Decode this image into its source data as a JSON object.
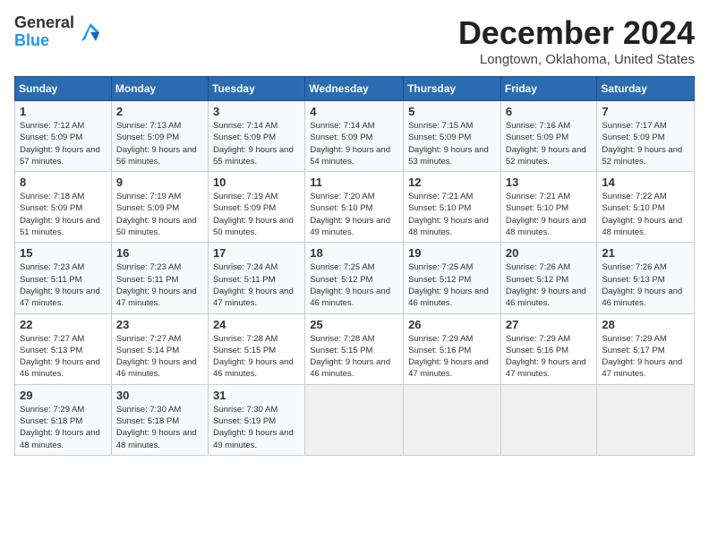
{
  "logo": {
    "general": "General",
    "blue": "Blue"
  },
  "title": "December 2024",
  "location": "Longtown, Oklahoma, United States",
  "days_of_week": [
    "Sunday",
    "Monday",
    "Tuesday",
    "Wednesday",
    "Thursday",
    "Friday",
    "Saturday"
  ],
  "weeks": [
    [
      {
        "day": "1",
        "sunrise": "7:12 AM",
        "sunset": "5:09 PM",
        "daylight": "9 hours and 57 minutes."
      },
      {
        "day": "2",
        "sunrise": "7:13 AM",
        "sunset": "5:09 PM",
        "daylight": "9 hours and 56 minutes."
      },
      {
        "day": "3",
        "sunrise": "7:14 AM",
        "sunset": "5:09 PM",
        "daylight": "9 hours and 55 minutes."
      },
      {
        "day": "4",
        "sunrise": "7:14 AM",
        "sunset": "5:09 PM",
        "daylight": "9 hours and 54 minutes."
      },
      {
        "day": "5",
        "sunrise": "7:15 AM",
        "sunset": "5:09 PM",
        "daylight": "9 hours and 53 minutes."
      },
      {
        "day": "6",
        "sunrise": "7:16 AM",
        "sunset": "5:09 PM",
        "daylight": "9 hours and 52 minutes."
      },
      {
        "day": "7",
        "sunrise": "7:17 AM",
        "sunset": "5:09 PM",
        "daylight": "9 hours and 52 minutes."
      }
    ],
    [
      {
        "day": "8",
        "sunrise": "7:18 AM",
        "sunset": "5:09 PM",
        "daylight": "9 hours and 51 minutes."
      },
      {
        "day": "9",
        "sunrise": "7:19 AM",
        "sunset": "5:09 PM",
        "daylight": "9 hours and 50 minutes."
      },
      {
        "day": "10",
        "sunrise": "7:19 AM",
        "sunset": "5:09 PM",
        "daylight": "9 hours and 50 minutes."
      },
      {
        "day": "11",
        "sunrise": "7:20 AM",
        "sunset": "5:10 PM",
        "daylight": "9 hours and 49 minutes."
      },
      {
        "day": "12",
        "sunrise": "7:21 AM",
        "sunset": "5:10 PM",
        "daylight": "9 hours and 48 minutes."
      },
      {
        "day": "13",
        "sunrise": "7:21 AM",
        "sunset": "5:10 PM",
        "daylight": "9 hours and 48 minutes."
      },
      {
        "day": "14",
        "sunrise": "7:22 AM",
        "sunset": "5:10 PM",
        "daylight": "9 hours and 48 minutes."
      }
    ],
    [
      {
        "day": "15",
        "sunrise": "7:23 AM",
        "sunset": "5:11 PM",
        "daylight": "9 hours and 47 minutes."
      },
      {
        "day": "16",
        "sunrise": "7:23 AM",
        "sunset": "5:11 PM",
        "daylight": "9 hours and 47 minutes."
      },
      {
        "day": "17",
        "sunrise": "7:24 AM",
        "sunset": "5:11 PM",
        "daylight": "9 hours and 47 minutes."
      },
      {
        "day": "18",
        "sunrise": "7:25 AM",
        "sunset": "5:12 PM",
        "daylight": "9 hours and 46 minutes."
      },
      {
        "day": "19",
        "sunrise": "7:25 AM",
        "sunset": "5:12 PM",
        "daylight": "9 hours and 46 minutes."
      },
      {
        "day": "20",
        "sunrise": "7:26 AM",
        "sunset": "5:12 PM",
        "daylight": "9 hours and 46 minutes."
      },
      {
        "day": "21",
        "sunrise": "7:26 AM",
        "sunset": "5:13 PM",
        "daylight": "9 hours and 46 minutes."
      }
    ],
    [
      {
        "day": "22",
        "sunrise": "7:27 AM",
        "sunset": "5:13 PM",
        "daylight": "9 hours and 46 minutes."
      },
      {
        "day": "23",
        "sunrise": "7:27 AM",
        "sunset": "5:14 PM",
        "daylight": "9 hours and 46 minutes."
      },
      {
        "day": "24",
        "sunrise": "7:28 AM",
        "sunset": "5:15 PM",
        "daylight": "9 hours and 46 minutes."
      },
      {
        "day": "25",
        "sunrise": "7:28 AM",
        "sunset": "5:15 PM",
        "daylight": "9 hours and 46 minutes."
      },
      {
        "day": "26",
        "sunrise": "7:29 AM",
        "sunset": "5:16 PM",
        "daylight": "9 hours and 47 minutes."
      },
      {
        "day": "27",
        "sunrise": "7:29 AM",
        "sunset": "5:16 PM",
        "daylight": "9 hours and 47 minutes."
      },
      {
        "day": "28",
        "sunrise": "7:29 AM",
        "sunset": "5:17 PM",
        "daylight": "9 hours and 47 minutes."
      }
    ],
    [
      {
        "day": "29",
        "sunrise": "7:29 AM",
        "sunset": "5:18 PM",
        "daylight": "9 hours and 48 minutes."
      },
      {
        "day": "30",
        "sunrise": "7:30 AM",
        "sunset": "5:18 PM",
        "daylight": "9 hours and 48 minutes."
      },
      {
        "day": "31",
        "sunrise": "7:30 AM",
        "sunset": "5:19 PM",
        "daylight": "9 hours and 49 minutes."
      },
      null,
      null,
      null,
      null
    ]
  ]
}
